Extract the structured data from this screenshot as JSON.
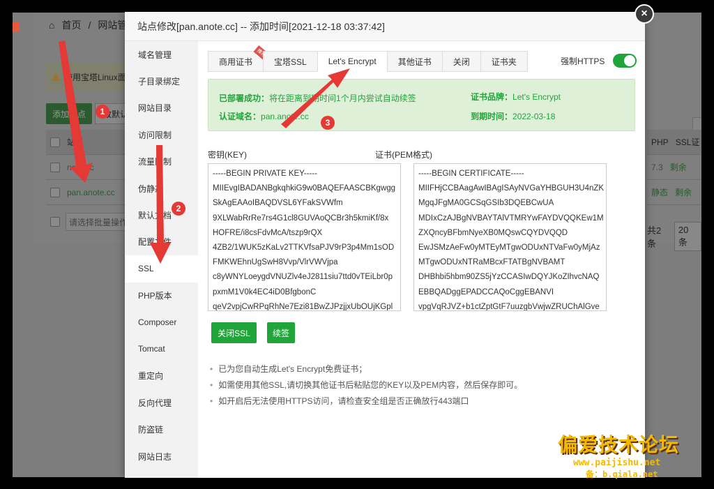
{
  "background": {
    "breadcrumb_home": "首页",
    "breadcrumb_sep": "/",
    "breadcrumb_current": "网站管",
    "tip": "使用宝塔Linux面",
    "add_site": "添加站点",
    "modify_default": "改默认",
    "col_site": "站名",
    "sites": [
      "note.cc",
      "pan.anote.cc"
    ],
    "batch_placeholder": "请选择批量操作",
    "col_php": "PHP",
    "col_ssl": "SSL证",
    "php_values": [
      "7.3",
      "静态"
    ],
    "ssl_values": [
      "剩余",
      "剩余"
    ],
    "total": "共2条",
    "per_page": "20条"
  },
  "modal": {
    "title": "站点修改[pan.anote.cc] -- 添加时间[2021-12-18 03:37:42]",
    "close_glyph": "×",
    "sidebar": [
      {
        "label": "域名管理",
        "active": false
      },
      {
        "label": "子目录绑定",
        "active": false
      },
      {
        "label": "网站目录",
        "active": false
      },
      {
        "label": "访问限制",
        "active": false
      },
      {
        "label": "流量限制",
        "active": false
      },
      {
        "label": "伪静态",
        "active": false
      },
      {
        "label": "默认文档",
        "active": false
      },
      {
        "label": "配置文件",
        "active": false
      },
      {
        "label": "SSL",
        "active": true
      },
      {
        "label": "PHP版本",
        "active": false
      },
      {
        "label": "Composer",
        "active": false
      },
      {
        "label": "Tomcat",
        "active": false
      },
      {
        "label": "重定向",
        "active": false
      },
      {
        "label": "反向代理",
        "active": false
      },
      {
        "label": "防盗链",
        "active": false
      },
      {
        "label": "网站日志",
        "active": false
      }
    ],
    "tabs": [
      {
        "label": "商用证书",
        "ribbon": "推荐",
        "active": false
      },
      {
        "label": "宝塔SSL",
        "active": false
      },
      {
        "label": "Let's Encrypt",
        "active": true
      },
      {
        "label": "其他证书",
        "active": false
      },
      {
        "label": "关闭",
        "active": false
      },
      {
        "label": "证书夹",
        "active": false
      }
    ],
    "force_https": {
      "label": "强制HTTPS",
      "enabled": true
    },
    "status": {
      "deployed_label": "已部署成功：",
      "deployed_value": "将在距离到期时间1个月内尝试自动续签",
      "domain_label": "认证域名：",
      "domain_value": "pan.anote.cc",
      "brand_label": "证书品牌：",
      "brand_value": "Let's Encrypt",
      "expire_label": "到期时间：",
      "expire_value": "2022-03-18"
    },
    "key_label": "密钥(KEY)",
    "cert_label": "证书(PEM格式)",
    "key_lines": [
      "-----BEGIN PRIVATE KEY-----",
      "MIIEvgIBADANBgkqhkiG9w0BAQEFAASCBKgwgg",
      "SkAgEAAoIBAQDVSL6YFakSVWfm",
      "9XLWabRrRe7rs4G1cl8GUVAoQCBr3h5kmiKf/8x",
      "HOFRE/i8csFdvMcA/tszp9rQX",
      "4ZB2/1WUK5zKaLv2TTKVfsaPJV9rP3p4Mm1sOD",
      "FMKWEhnUgSwH8Vvp/VlrVWVjpa",
      "c8yWNYLoeygdVNUZlv4eJ2811siu7ttd0vTEiLbr0p",
      "pxmM1V0k4EC4iD0BfgbonC",
      "qeV2vpjCwRPqRhNe7Ezi81BwZJPzjjxUbOUjKGpl"
    ],
    "cert_lines": [
      "-----BEGIN CERTIFICATE-----",
      "MIIFHjCCBAagAwIBAgISAyNVGaYHBGUH3U4nZK",
      "MgqJFgMA0GCSqGSIb3DQEBCwUA",
      "MDIxCzAJBgNVBAYTAlVTMRYwFAYDVQQKEw1M",
      "ZXQncyBFbmNyeXB0MQswCQYDVQQD",
      "EwJSMzAeFw0yMTEyMTgwODUxNTVaFw0yMjAz",
      "MTgwODUxNTRaMBcxFTATBgNVBAMT",
      "DHBhbi5hbm90ZS5jYzCCASIwDQYJKoZIhvcNAQ",
      "EBBQADggEPADCCAQoCggEBANVI",
      "vpgVqRJVZ+b1ctZptGtF7uuzgbVwjwZRUChAlGve"
    ],
    "btn_close_ssl": "关闭SSL",
    "btn_renew": "续签",
    "notes": [
      "已为您自动生成Let's Encrypt免费证书；",
      "如需使用其他SSL,请切换其他证书后粘贴您的KEY以及PEM内容，然后保存即可。",
      "如开启后无法使用HTTPS访问，请检查安全组是否正确放行443端口"
    ]
  },
  "annotations": {
    "badge1": "1",
    "badge2": "2",
    "badge3": "3"
  },
  "watermark": {
    "title": "偏爱技术论坛",
    "url": "www.paijishu.net",
    "backup": "备：b.qiala.net"
  },
  "colors": {
    "accent_green": "#20a53a",
    "status_bg": "#dff0d8",
    "arrow_red": "#e53935",
    "watermark": "#f5b800"
  }
}
